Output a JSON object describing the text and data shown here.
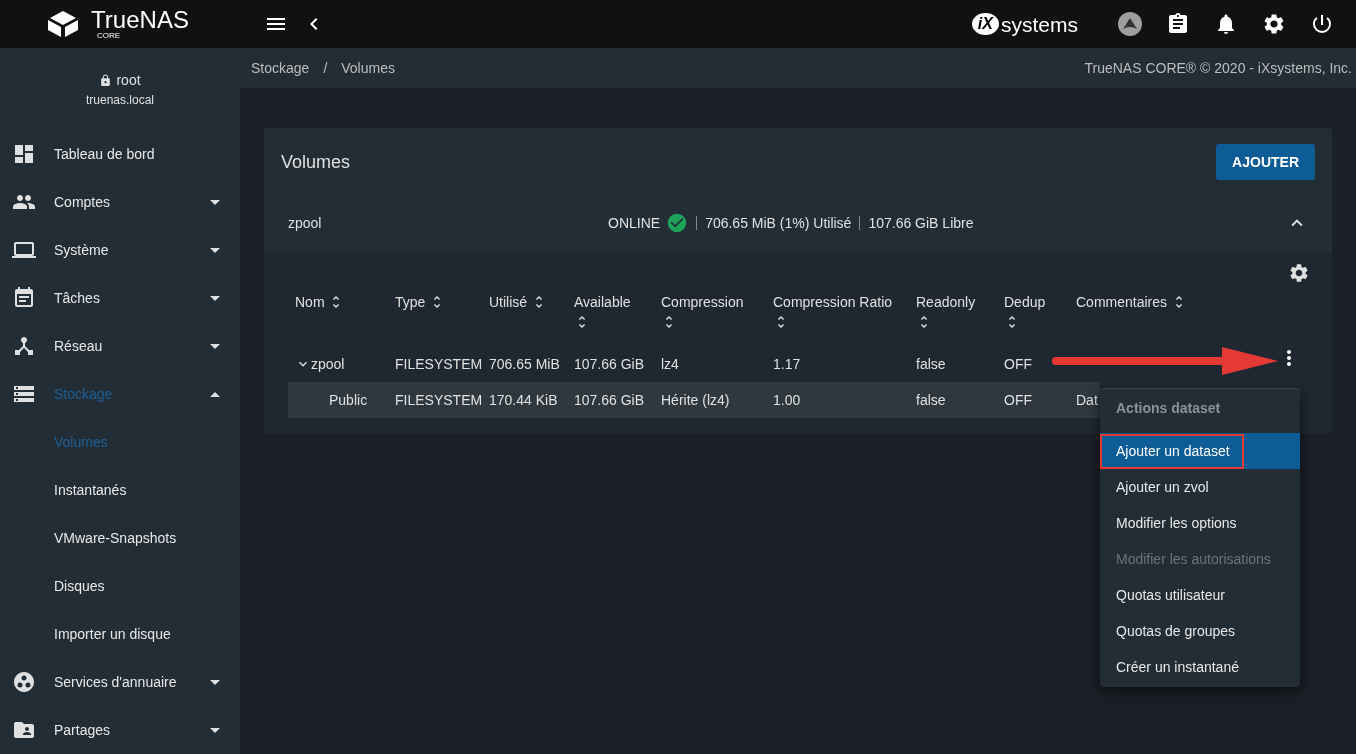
{
  "topbar": {
    "logo_text": "TrueNAS",
    "logo_sub": "CORE",
    "vendor_mark": "iX",
    "vendor_text": "systems"
  },
  "sidebar": {
    "user": "root",
    "host": "truenas.local",
    "items": [
      {
        "label": "Tableau de bord",
        "selected": false
      },
      {
        "label": "Comptes",
        "selected": false,
        "expanded": false
      },
      {
        "label": "Système",
        "selected": false,
        "expanded": false
      },
      {
        "label": "Tâches",
        "selected": false,
        "expanded": false
      },
      {
        "label": "Réseau",
        "selected": false,
        "expanded": false
      },
      {
        "label": "Stockage",
        "selected": true,
        "expanded": true,
        "children": [
          {
            "label": "Volumes",
            "selected": true
          },
          {
            "label": "Instantanés",
            "selected": false
          },
          {
            "label": "VMware-Snapshots",
            "selected": false
          },
          {
            "label": "Disques",
            "selected": false
          },
          {
            "label": "Importer un disque",
            "selected": false
          }
        ]
      },
      {
        "label": "Services d'annuaire",
        "selected": false,
        "expanded": false
      },
      {
        "label": "Partages",
        "selected": false,
        "expanded": false
      }
    ]
  },
  "breadcrumb": [
    "Stockage",
    "Volumes"
  ],
  "breadcrumb_separator": "/",
  "copyright": "TrueNAS CORE® © 2020 - iXsystems, Inc.",
  "card": {
    "title": "Volumes",
    "add_button": "AJOUTER",
    "pool": {
      "name": "zpool",
      "status": "ONLINE",
      "used": "706.65 MiB (1%) Utilisé",
      "free": "107.66 GiB Libre",
      "expanded": true
    },
    "table": {
      "columns": [
        "Nom",
        "Type",
        "Utilisé",
        "Available",
        "Compression",
        "Compression Ratio",
        "Readonly",
        "Dedup",
        "Commentaires"
      ],
      "rows": [
        {
          "cells": [
            "zpool",
            "FILESYSTEM",
            "706.65 MiB",
            "107.66 GiB",
            "lz4",
            "1.17",
            "false",
            "OFF",
            ""
          ],
          "selected": false,
          "expanded": true,
          "children": [
            {
              "cells": [
                "Public",
                "FILESYSTEM",
                "170.44 KiB",
                "107.66 GiB",
                "Hérite (lz4)",
                "1.00",
                "false",
                "OFF",
                "Dat"
              ],
              "selected": true
            }
          ]
        }
      ]
    }
  },
  "menu": {
    "title": "Actions dataset",
    "items": [
      {
        "label": "Ajouter un dataset",
        "selected": true,
        "disabled": false
      },
      {
        "label": "Ajouter un zvol",
        "selected": false,
        "disabled": false
      },
      {
        "label": "Modifier les options",
        "selected": false,
        "disabled": false
      },
      {
        "label": "Modifier les autorisations",
        "selected": false,
        "disabled": true
      },
      {
        "label": "Quotas utilisateur",
        "selected": false,
        "disabled": false
      },
      {
        "label": "Quotas de groupes",
        "selected": false,
        "disabled": false
      },
      {
        "label": "Créer un instantané",
        "selected": false,
        "disabled": false
      }
    ]
  }
}
